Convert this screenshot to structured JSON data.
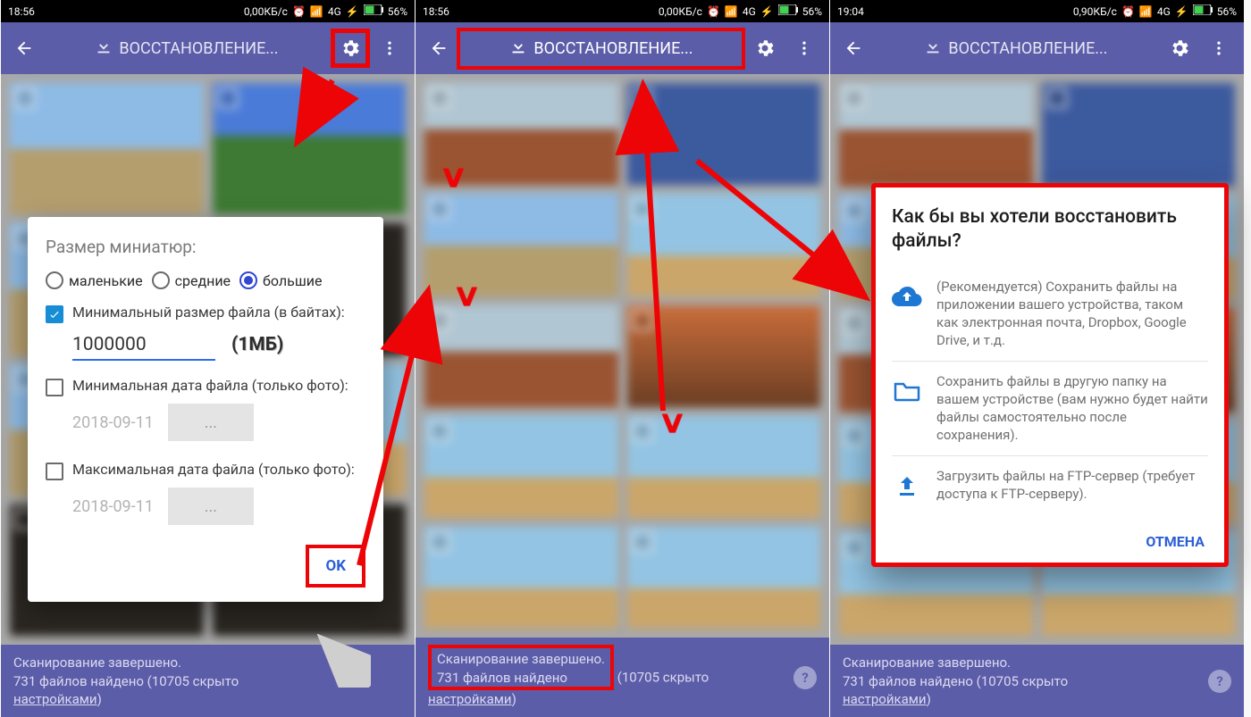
{
  "status": {
    "time1": "18:56",
    "time2": "18:56",
    "time3": "19:04",
    "speed1": "0,00КБ/с",
    "speed3": "0,90КБ/с",
    "net": "4G",
    "bat": "56%"
  },
  "appbar": {
    "title": "ВОССТАНОВЛЕНИЕ..."
  },
  "dialog1": {
    "heading": "Размер миниатюр:",
    "radio": {
      "small": "маленькие",
      "medium": "средние",
      "large": "большие"
    },
    "minsize_label": "Минимальный размер файла (в байтах):",
    "minsize_value": "1000000",
    "minsize_hint": "(1МБ)",
    "mindate_label": "Минимальная дата файла (только фото):",
    "mindate_value": "2018-09-11",
    "mindate_btn": "...",
    "maxdate_label": "Максимальная дата файла (только фото):",
    "maxdate_value": "2018-09-11",
    "maxdate_btn": "...",
    "ok": "OK"
  },
  "footer": {
    "line1": "Сканирование завершено.",
    "line2a": "731 файлов найдено",
    "line2b": " (10705 скрыто ",
    "settings": "настройками",
    "close": ")"
  },
  "dialog3": {
    "heading": "Как бы вы хотели восстановить файлы?",
    "opt1": "(Рекомендуется) Сохранить файлы на приложении вашего устройства, таком как электронная почта, Dropbox, Google Drive, и т.д.",
    "opt2": "Сохранить файлы в другую папку на вашем устройстве (вам нужно будет найти файлы самостоятельно после сохранения).",
    "opt3": "Загрузить файлы на FTP-сервер (требует доступа к FTP-серверу).",
    "cancel": "ОТМЕНА"
  }
}
